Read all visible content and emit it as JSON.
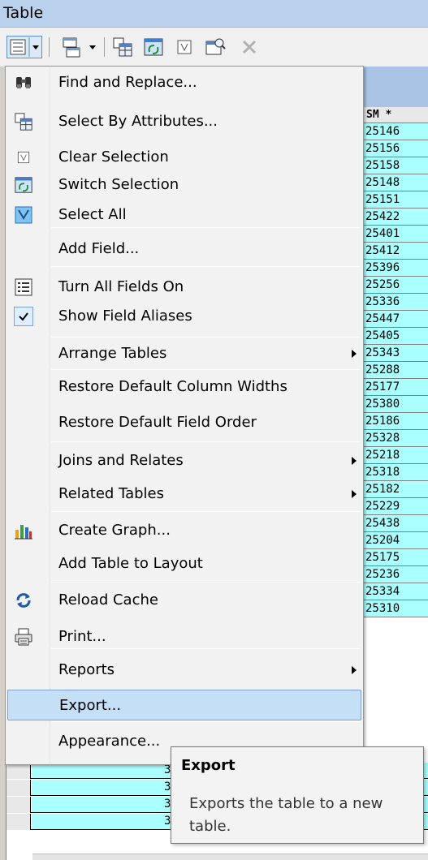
{
  "window": {
    "title": "Table"
  },
  "toolbar": {
    "buttons": [
      {
        "name": "table-options-icon"
      },
      {
        "name": "related-tables-icon"
      },
      {
        "name": "select-by-attributes-icon"
      },
      {
        "name": "switch-selection-icon"
      },
      {
        "name": "clear-selection-icon"
      },
      {
        "name": "zoom-to-selected-icon"
      },
      {
        "name": "delete-selected-icon"
      }
    ]
  },
  "table": {
    "visible_column_header": "SM *",
    "values": [
      "25146",
      "25156",
      "25158",
      "25148",
      "25151",
      "25422",
      "25401",
      "25412",
      "25396",
      "25256",
      "25336",
      "25447",
      "25405",
      "25343",
      "25288",
      "25177",
      "25380",
      "25186",
      "25328",
      "25218",
      "25318",
      "25182",
      "25229",
      "25438",
      "25204",
      "25175",
      "25236",
      "25334",
      "25310"
    ],
    "lower_rows": [
      "3",
      "3",
      "3",
      "3"
    ],
    "colors": {
      "cell": "#aaffff",
      "header_band": "#a9c4e4"
    }
  },
  "menu": {
    "items": [
      {
        "label": "Find and Replace...",
        "icon": "binoculars-icon"
      },
      {
        "label": "Select By Attributes...",
        "icon": "select-by-attributes-icon"
      },
      {
        "label": "Clear Selection",
        "icon": "clear-selection-icon"
      },
      {
        "label": "Switch Selection",
        "icon": "switch-selection-icon"
      },
      {
        "label": "Select All",
        "icon": "select-all-icon"
      },
      {
        "label": "Add Field...",
        "icon": ""
      },
      {
        "label": "Turn All Fields On",
        "icon": "list-fields-icon"
      },
      {
        "label": "Show Field Aliases",
        "icon": "checkmark-icon",
        "checked": true
      },
      {
        "label": "Arrange Tables",
        "submenu": true
      },
      {
        "label": "Restore Default Column Widths"
      },
      {
        "label": "Restore Default Field Order"
      },
      {
        "label": "Joins and Relates",
        "submenu": true
      },
      {
        "label": "Related Tables",
        "submenu": true
      },
      {
        "label": "Create Graph...",
        "icon": "bar-chart-icon"
      },
      {
        "label": "Add Table to Layout"
      },
      {
        "label": "Reload Cache",
        "icon": "reload-icon"
      },
      {
        "label": "Print...",
        "icon": "printer-icon"
      },
      {
        "label": "Reports",
        "submenu": true
      },
      {
        "label": "Export...",
        "highlighted": true
      },
      {
        "label": "Appearance..."
      }
    ],
    "highlight_color": "#c5dff7"
  },
  "tooltip": {
    "title": "Export",
    "text": "Exports the table to a new table."
  }
}
